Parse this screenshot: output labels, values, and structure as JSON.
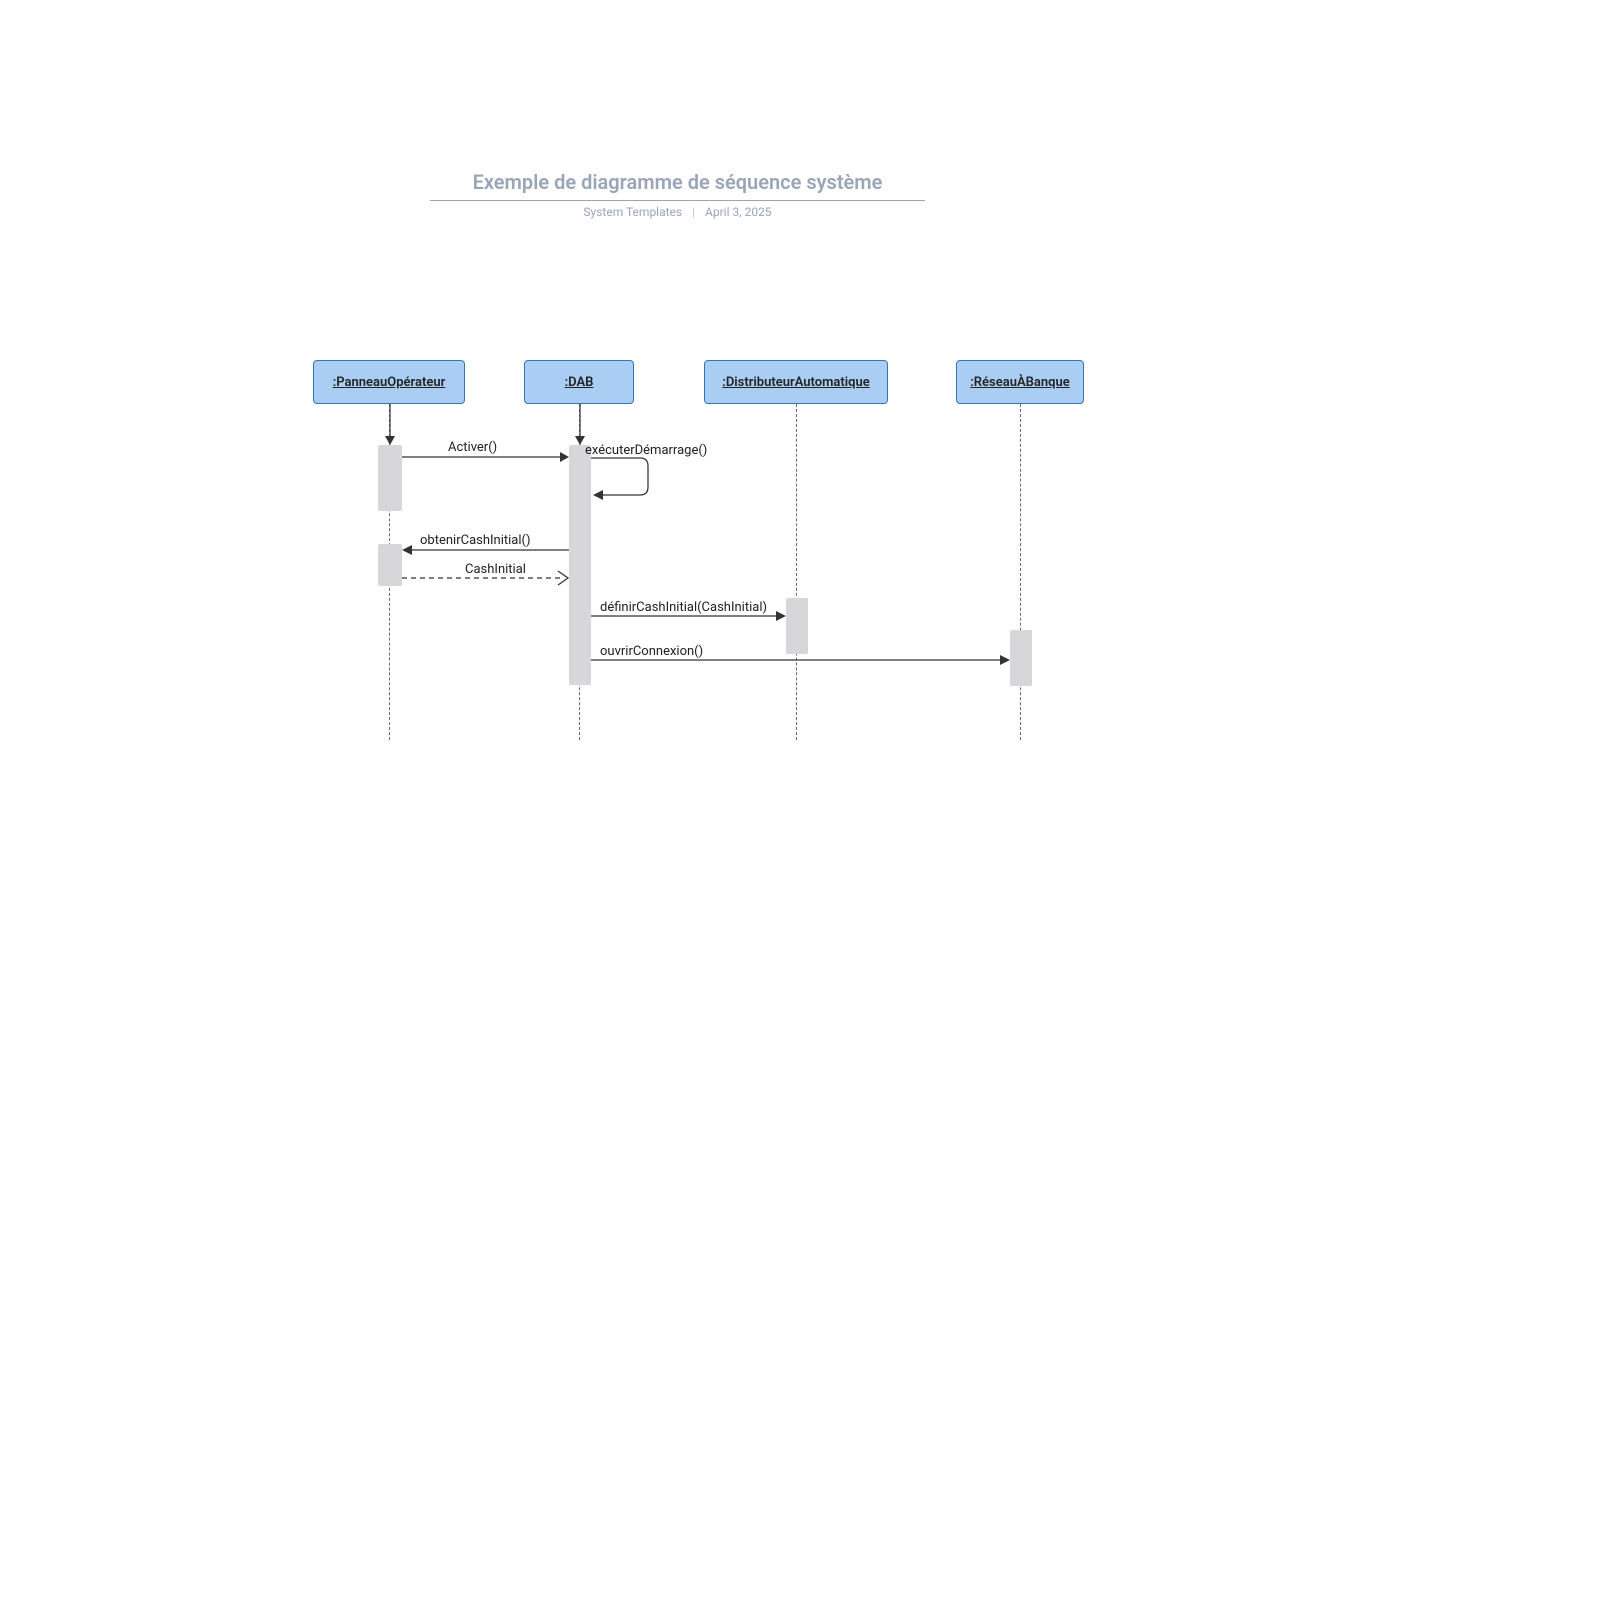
{
  "title": "Exemple de diagramme de séquence système",
  "subtitle_left": "System Templates",
  "subtitle_right": "April 3, 2025",
  "participants": {
    "p1": ":PanneauOpérateur",
    "p2": ":DAB",
    "p3": ":DistributeurAutomatique",
    "p4": ":RéseauÀBanque"
  },
  "messages": {
    "m1": "Activer()",
    "m2": "exécuterDémarrage()",
    "m3": "obtenirCashInitial()",
    "m4": "CashInitial",
    "m5": "définirCashInitial(CashInitial)",
    "m6": "ouvrirConnexion()"
  }
}
